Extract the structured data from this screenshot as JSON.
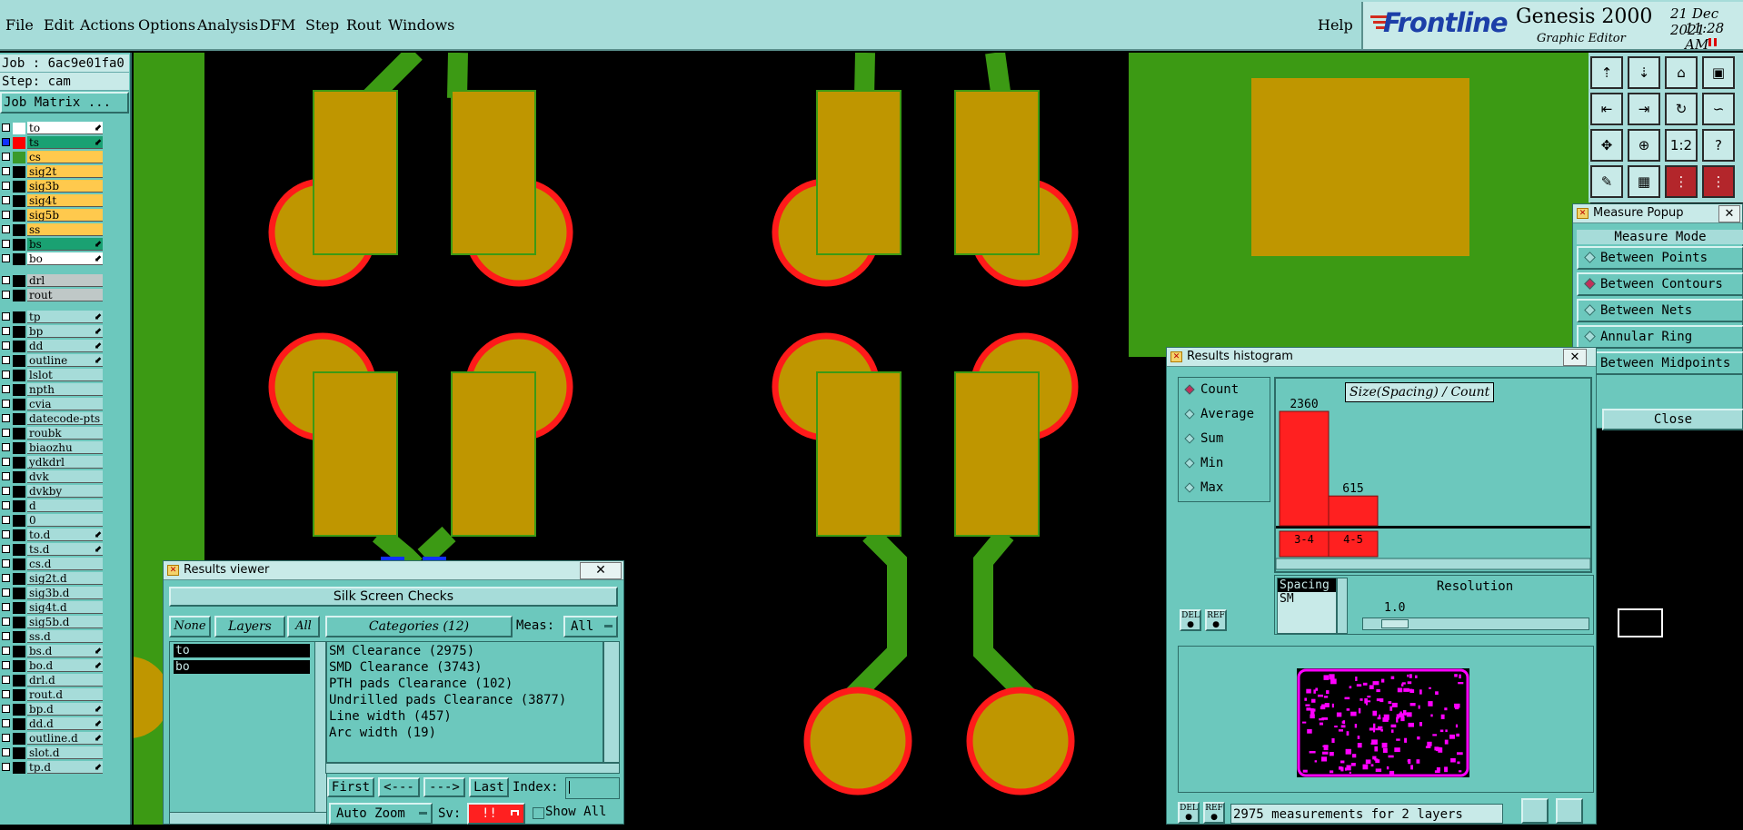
{
  "menu": {
    "items": [
      "File",
      "Edit",
      "Actions",
      "Options",
      "Analysis",
      "DFM",
      "Step",
      "Rout",
      "Windows"
    ],
    "help": "Help"
  },
  "brand": {
    "logo": "Frontline",
    "product": "Genesis 2000",
    "subtitle": "Graphic Editor",
    "date": "21 Dec 2021",
    "time": "11:28 AM"
  },
  "job": {
    "job_line": "Job : 6ac9e01fa0",
    "step_line": "Step: cam",
    "matrix_button": "Job Matrix ..."
  },
  "layers": [
    {
      "name": "to",
      "color": "#ffffff",
      "swatch": "#ffffff",
      "arrow": true
    },
    {
      "name": "ts",
      "color": "#1aa172",
      "swatch": "#ff0000",
      "arrow": true
    },
    {
      "name": "cs",
      "color": "#ffc94d",
      "swatch": "#3a9a2a",
      "arrow": false
    },
    {
      "name": "sig2t",
      "color": "#ffc94d",
      "swatch": "",
      "arrow": false
    },
    {
      "name": "sig3b",
      "color": "#ffc94d",
      "swatch": "",
      "arrow": false
    },
    {
      "name": "sig4t",
      "color": "#ffc94d",
      "swatch": "",
      "arrow": false
    },
    {
      "name": "sig5b",
      "color": "#ffc94d",
      "swatch": "",
      "arrow": false
    },
    {
      "name": "ss",
      "color": "#ffc94d",
      "swatch": "",
      "arrow": false
    },
    {
      "name": "bs",
      "color": "#1aa172",
      "swatch": "",
      "arrow": true
    },
    {
      "name": "bo",
      "color": "#ffffff",
      "swatch": "",
      "arrow": true
    },
    {
      "name": "drl",
      "color": "#bfc8c7",
      "swatch": "",
      "arrow": false
    },
    {
      "name": "rout",
      "color": "#bfc8c7",
      "swatch": "",
      "arrow": false
    },
    {
      "name": "tp",
      "color": "#a6dcd9",
      "swatch": "",
      "arrow": true
    },
    {
      "name": "bp",
      "color": "#a6dcd9",
      "swatch": "",
      "arrow": true
    },
    {
      "name": "dd",
      "color": "#a6dcd9",
      "swatch": "",
      "arrow": true
    },
    {
      "name": "outline",
      "color": "#a6dcd9",
      "swatch": "",
      "arrow": true
    },
    {
      "name": "lslot",
      "color": "#a6dcd9",
      "swatch": "",
      "arrow": false
    },
    {
      "name": "npth",
      "color": "#a6dcd9",
      "swatch": "",
      "arrow": false
    },
    {
      "name": "cvia",
      "color": "#a6dcd9",
      "swatch": "",
      "arrow": false
    },
    {
      "name": "datecode-pts",
      "color": "#a6dcd9",
      "swatch": "",
      "arrow": false
    },
    {
      "name": "roubk",
      "color": "#a6dcd9",
      "swatch": "",
      "arrow": false
    },
    {
      "name": "biaozhu",
      "color": "#a6dcd9",
      "swatch": "",
      "arrow": false
    },
    {
      "name": "ydkdrl",
      "color": "#a6dcd9",
      "swatch": "",
      "arrow": false
    },
    {
      "name": "dvk",
      "color": "#a6dcd9",
      "swatch": "",
      "arrow": false
    },
    {
      "name": "dvkby",
      "color": "#a6dcd9",
      "swatch": "",
      "arrow": false
    },
    {
      "name": "d",
      "color": "#a6dcd9",
      "swatch": "",
      "arrow": false
    },
    {
      "name": "0",
      "color": "#a6dcd9",
      "swatch": "",
      "arrow": false
    },
    {
      "name": "to.d",
      "color": "#a6dcd9",
      "swatch": "",
      "arrow": true
    },
    {
      "name": "ts.d",
      "color": "#a6dcd9",
      "swatch": "",
      "arrow": true
    },
    {
      "name": "cs.d",
      "color": "#a6dcd9",
      "swatch": "",
      "arrow": false
    },
    {
      "name": "sig2t.d",
      "color": "#a6dcd9",
      "swatch": "",
      "arrow": false
    },
    {
      "name": "sig3b.d",
      "color": "#a6dcd9",
      "swatch": "",
      "arrow": false
    },
    {
      "name": "sig4t.d",
      "color": "#a6dcd9",
      "swatch": "",
      "arrow": false
    },
    {
      "name": "sig5b.d",
      "color": "#a6dcd9",
      "swatch": "",
      "arrow": false
    },
    {
      "name": "ss.d",
      "color": "#a6dcd9",
      "swatch": "",
      "arrow": false
    },
    {
      "name": "bs.d",
      "color": "#a6dcd9",
      "swatch": "",
      "arrow": true
    },
    {
      "name": "bo.d",
      "color": "#a6dcd9",
      "swatch": "",
      "arrow": true
    },
    {
      "name": "drl.d",
      "color": "#a6dcd9",
      "swatch": "",
      "arrow": false
    },
    {
      "name": "rout.d",
      "color": "#a6dcd9",
      "swatch": "",
      "arrow": false
    },
    {
      "name": "bp.d",
      "color": "#a6dcd9",
      "swatch": "",
      "arrow": true
    },
    {
      "name": "dd.d",
      "color": "#a6dcd9",
      "swatch": "",
      "arrow": true
    },
    {
      "name": "outline.d",
      "color": "#a6dcd9",
      "swatch": "",
      "arrow": true
    },
    {
      "name": "slot.d",
      "color": "#a6dcd9",
      "swatch": "",
      "arrow": false
    },
    {
      "name": "tp.d",
      "color": "#a6dcd9",
      "swatch": "",
      "arrow": true
    }
  ],
  "toolbar": {
    "icons": [
      "layer-up-icon",
      "layer-down-icon",
      "home-icon",
      "frame-icon",
      "move-left-icon",
      "move-right-icon",
      "redo-icon",
      "snap-icon",
      "fit-icon",
      "zoom-icon",
      "scale-1-2-icon",
      "help-icon",
      "draw-icon",
      "grid-icon",
      "route-net-icon",
      "route-net-alt-icon"
    ],
    "scale_label": "1:2",
    "help_label": "?"
  },
  "measure_popup": {
    "title": "Measure Popup",
    "header": "Measure Mode",
    "modes": [
      "Between Points",
      "Between Contours",
      "Between Nets",
      "Annular Ring",
      "Between Midpoints"
    ],
    "selected": 1,
    "close": "Close"
  },
  "results_viewer": {
    "title": "Results viewer",
    "heading": "Silk Screen Checks",
    "none": "None",
    "layers": "Layers",
    "all": "All",
    "categories": "Categories (12)",
    "meas_label": "Meas:",
    "meas_value": "All",
    "layer_list": [
      "to",
      "bo"
    ],
    "category_list": [
      "SM Clearance (2975)",
      "SMD Clearance (3743)",
      "PTH pads Clearance (102)",
      "Undrilled pads Clearance (3877)",
      "Line width (457)",
      "Arc width (19)"
    ],
    "first": "First",
    "prev": "<---",
    "next": "--->",
    "last": "Last",
    "index_label": "Index:",
    "auto_zoom": "Auto Zoom",
    "sv_label": "Sv:",
    "sv_value": "!!",
    "show_all": "Show All"
  },
  "histogram": {
    "title": "Results histogram",
    "modes": [
      "Count",
      "Average",
      "Sum",
      "Min",
      "Max"
    ],
    "selected": 0,
    "chart_title": "Size(Spacing) / Count",
    "spacing_label": "Spacing",
    "sm_label": "SM",
    "resolution_label": "Resolution",
    "resolution_value": "1.0",
    "del": "DEL",
    "ref": "REF",
    "status": "2975 measurements for 2 layers"
  },
  "chart_data": {
    "type": "bar",
    "title": "Size(Spacing) / Count",
    "categories": [
      "3-4",
      "4-5"
    ],
    "values": [
      2360,
      615
    ],
    "colors": {
      "bar": "#ff2020",
      "background": "#a6dcd9"
    }
  },
  "colors": {
    "ui_panel": "#6cc8bd",
    "ui_light": "#a6dcd9",
    "pad_gold": "#bf9600",
    "pad_outline": "#ff1a1a",
    "copper_green": "#3c9a14",
    "highlight_blue": "#1030ff",
    "magenta": "#ff00ff"
  }
}
